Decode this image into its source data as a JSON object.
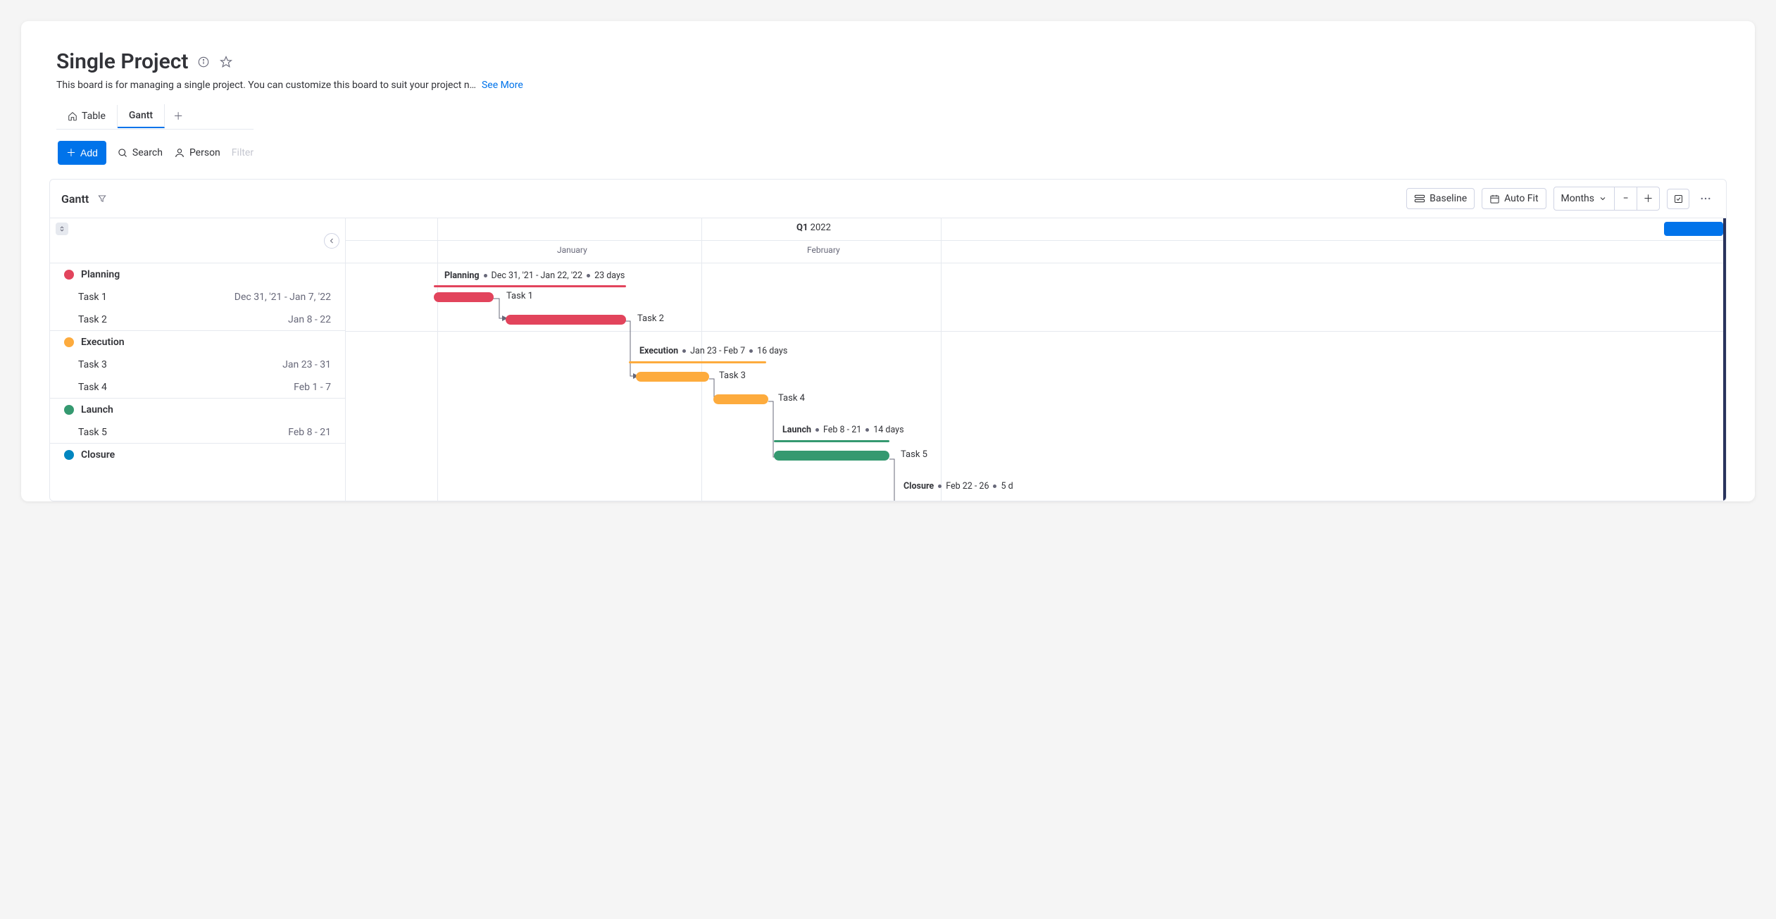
{
  "header": {
    "title": "Single Project",
    "description": "This board is for managing a single project. You can customize this board to suit your project n…",
    "see_more": "See More"
  },
  "tabs": [
    {
      "label": "Table"
    },
    {
      "label": "Gantt"
    }
  ],
  "toolbar": {
    "add_label": "Add",
    "search_label": "Search",
    "person_label": "Person",
    "filter_hint": "Filter"
  },
  "gantt": {
    "title": "Gantt",
    "controls": {
      "baseline": "Baseline",
      "auto_fit": "Auto Fit",
      "scale": "Months"
    },
    "timeline": {
      "quarter_prefix": "Q1",
      "quarter_year": "2022",
      "months": [
        "January",
        "February"
      ]
    },
    "groups": [
      {
        "name": "Planning",
        "color": "#e2445c",
        "summary_dates": "Dec 31, '21 - Jan 22, '22",
        "summary_duration": "23 days",
        "tasks": [
          {
            "name": "Task 1",
            "dates": "Dec 31, '21 - Jan 7, '22",
            "bar_label": "Task 1"
          },
          {
            "name": "Task 2",
            "dates": "Jan 8 - 22",
            "bar_label": "Task 2"
          }
        ]
      },
      {
        "name": "Execution",
        "color": "#fdab3d",
        "summary_dates": "Jan 23 - Feb 7",
        "summary_duration": "16 days",
        "tasks": [
          {
            "name": "Task 3",
            "dates": "Jan 23 - 31",
            "bar_label": "Task 3"
          },
          {
            "name": "Task 4",
            "dates": "Feb 1 - 7",
            "bar_label": "Task 4"
          }
        ]
      },
      {
        "name": "Launch",
        "color": "#359970",
        "summary_dates": "Feb 8 - 21",
        "summary_duration": "14 days",
        "tasks": [
          {
            "name": "Task 5",
            "dates": "Feb 8 - 21",
            "bar_label": "Task 5"
          }
        ]
      },
      {
        "name": "Closure",
        "color": "#0086c0",
        "summary_dates": "Feb 22 - 26",
        "summary_duration": "5 d"
      }
    ]
  },
  "chart_data": {
    "type": "gantt",
    "title": "Single Project Gantt",
    "time_axis": {
      "unit": "months",
      "range": [
        "2021-12-31",
        "2022-03-05"
      ]
    },
    "groups": [
      {
        "name": "Planning",
        "color": "#e2445c",
        "start": "2021-12-31",
        "end": "2022-01-22",
        "duration_days": 23,
        "tasks": [
          {
            "name": "Task 1",
            "start": "2021-12-31",
            "end": "2022-01-07"
          },
          {
            "name": "Task 2",
            "start": "2022-01-08",
            "end": "2022-01-22"
          }
        ]
      },
      {
        "name": "Execution",
        "color": "#fdab3d",
        "start": "2022-01-23",
        "end": "2022-02-07",
        "duration_days": 16,
        "tasks": [
          {
            "name": "Task 3",
            "start": "2022-01-23",
            "end": "2022-01-31"
          },
          {
            "name": "Task 4",
            "start": "2022-02-01",
            "end": "2022-02-07"
          }
        ]
      },
      {
        "name": "Launch",
        "color": "#359970",
        "start": "2022-02-08",
        "end": "2022-02-21",
        "duration_days": 14,
        "tasks": [
          {
            "name": "Task 5",
            "start": "2022-02-08",
            "end": "2022-02-21"
          }
        ]
      },
      {
        "name": "Closure",
        "color": "#0086c0",
        "start": "2022-02-22",
        "end": "2022-02-26",
        "duration_days": 5,
        "tasks": []
      }
    ],
    "dependencies": [
      [
        "Task 1",
        "Task 2"
      ],
      [
        "Task 2",
        "Task 3"
      ],
      [
        "Task 3",
        "Task 4"
      ],
      [
        "Task 4",
        "Task 5"
      ]
    ]
  }
}
